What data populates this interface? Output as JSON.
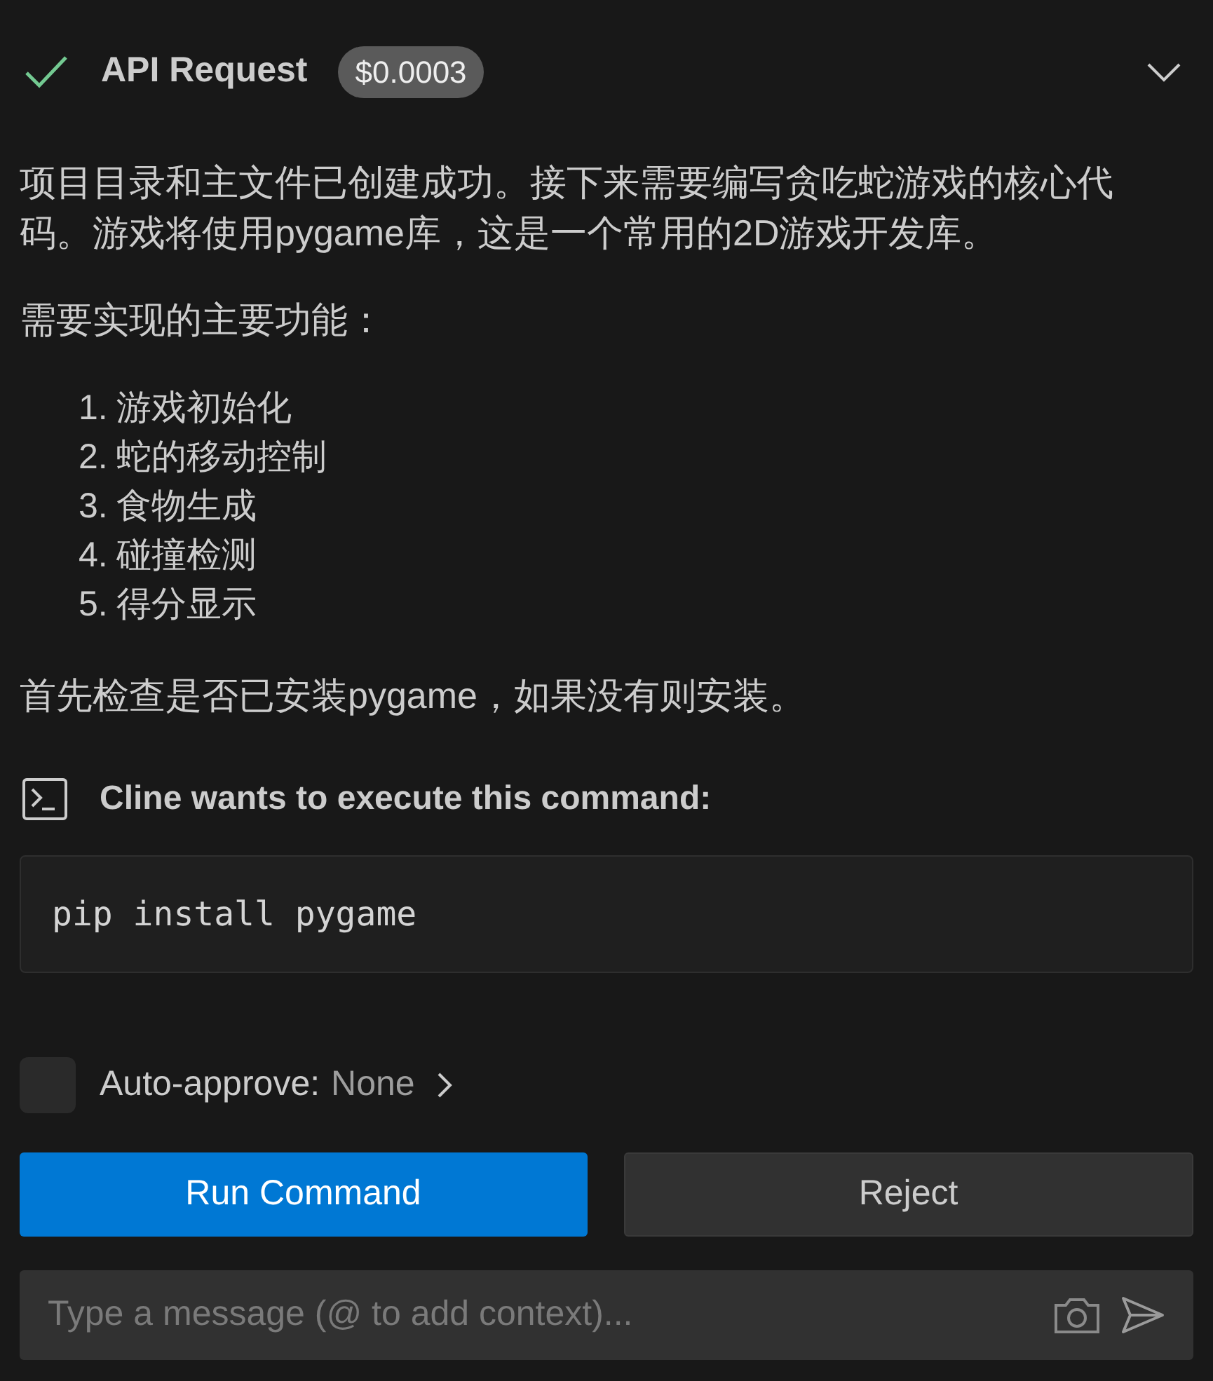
{
  "request": {
    "title": "API Request",
    "cost": "$0.0003",
    "expanded": false
  },
  "message": {
    "intro": "项目目录和主文件已创建成功。接下来需要编写贪吃蛇游戏的核心代码。游戏将使用pygame库，这是一个常用的2D游戏开发库。",
    "list_title": "需要实现的主要功能：",
    "items": [
      {
        "number": "1.",
        "text": "游戏初始化"
      },
      {
        "number": "2.",
        "text": "蛇的移动控制"
      },
      {
        "number": "3.",
        "text": "食物生成"
      },
      {
        "number": "4.",
        "text": "碰撞检测"
      },
      {
        "number": "5.",
        "text": "得分显示"
      }
    ],
    "outro": "首先检查是否已安装pygame，如果没有则安装。"
  },
  "command": {
    "title": "Cline wants to execute this command:",
    "code": "pip install pygame"
  },
  "auto_approve": {
    "checked": false,
    "label": "Auto-approve:",
    "value": "None"
  },
  "buttons": [
    {
      "label": "Run Command",
      "kind": "primary"
    },
    {
      "label": "Reject",
      "kind": "secondary"
    }
  ],
  "input": {
    "placeholder": "Type a message (@ to add context)..."
  }
}
